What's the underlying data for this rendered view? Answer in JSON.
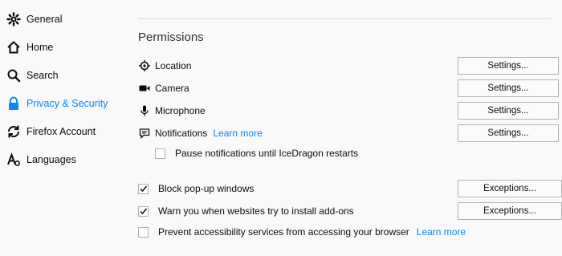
{
  "sidebar": {
    "items": [
      {
        "label": "General",
        "icon": "gear-icon"
      },
      {
        "label": "Home",
        "icon": "home-icon"
      },
      {
        "label": "Search",
        "icon": "search-icon"
      },
      {
        "label": "Privacy & Security",
        "icon": "lock-icon",
        "selected": true
      },
      {
        "label": "Firefox Account",
        "icon": "sync-icon"
      },
      {
        "label": "Languages",
        "icon": "languages-icon"
      }
    ]
  },
  "permissions": {
    "title": "Permissions",
    "rows": [
      {
        "label": "Location",
        "icon": "location-icon",
        "button": "Settings..."
      },
      {
        "label": "Camera",
        "icon": "camera-icon",
        "button": "Settings..."
      },
      {
        "label": "Microphone",
        "icon": "microphone-icon",
        "button": "Settings..."
      },
      {
        "label": "Notifications",
        "icon": "notification-icon",
        "button": "Settings...",
        "link": "Learn more"
      }
    ],
    "pause_notifications": {
      "label": "Pause notifications until IceDragon restarts",
      "checked": false
    },
    "block_popups": {
      "label": "Block pop-up windows",
      "checked": true,
      "button": "Exceptions..."
    },
    "warn_addons": {
      "label": "Warn you when websites try to install add-ons",
      "checked": true,
      "button": "Exceptions..."
    },
    "prevent_accessibility": {
      "label": "Prevent accessibility services from accessing your browser",
      "checked": false,
      "link": "Learn more"
    }
  },
  "colors": {
    "accent": "#0a84ff",
    "background": "#f9f9fa",
    "border": "#b1b1b3"
  }
}
